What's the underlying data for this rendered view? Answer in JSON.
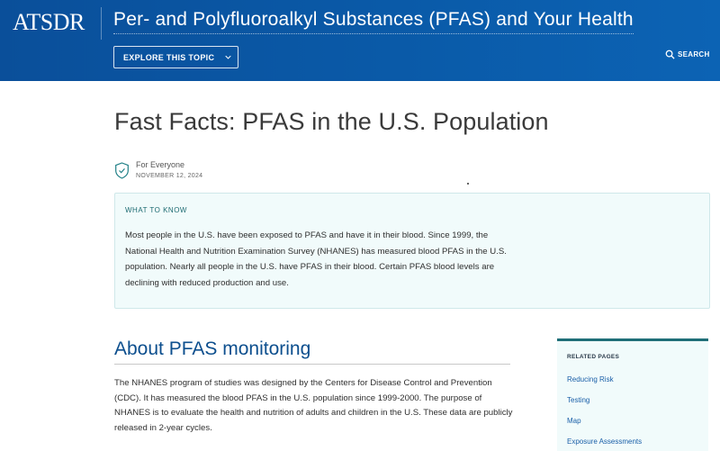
{
  "header": {
    "logo_text": "ATSDR",
    "site_title": "Per- and Polyfluoroalkyl Substances (PFAS) and Your Health",
    "explore_label": "EXPLORE THIS TOPIC",
    "search_label": "SEARCH"
  },
  "page": {
    "title": "Fast Facts: PFAS in the U.S. Population",
    "audience": "For Everyone",
    "date": "NOVEMBER 12, 2024"
  },
  "what_to_know": {
    "heading": "WHAT TO KNOW",
    "text": "Most people in the U.S. have been exposed to PFAS and have it in their blood. Since 1999, the National Health and Nutrition Examination Survey (NHANES) has measured blood PFAS in the U.S. population. Nearly all people in the U.S. have PFAS in their blood. Certain PFAS blood levels are declining with reduced production and use."
  },
  "section": {
    "heading": "About PFAS monitoring",
    "body": "The NHANES program of studies was designed by the Centers for Disease Control and Prevention (CDC). It has measured the blood PFAS in the U.S. population since 1999-2000. The purpose of NHANES is to evaluate the health and nutrition of adults and children in the U.S. These data are publicly released in 2-year cycles."
  },
  "related": {
    "heading": "RELATED PAGES",
    "links": [
      "Reducing Risk",
      "Testing",
      "Map",
      "Exposure Assessments"
    ]
  },
  "colors": {
    "header_blue": "#0a5aa8",
    "section_heading_blue": "#0d4f8e",
    "teal_accent": "#1f6f78",
    "panel_bg": "#f1fbfb",
    "link_blue": "#1a5fa8"
  },
  "icons": [
    "chevron-down-icon",
    "search-icon",
    "shield-icon"
  ]
}
